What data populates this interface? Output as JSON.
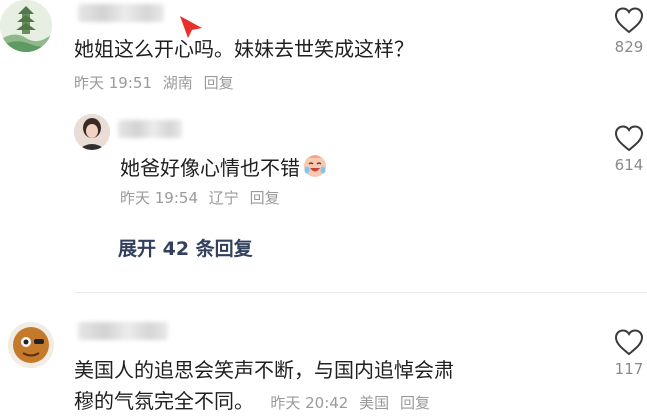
{
  "comments": [
    {
      "text": "她姐这么开心吗。妹妹去世笑成这样？",
      "time": "昨天 19:51",
      "region": "湖南",
      "reply_label": "回复",
      "like_count": "829"
    },
    {
      "text": "她爸好像心情也不错",
      "time": "昨天 19:54",
      "region": "辽宁",
      "reply_label": "回复",
      "like_count": "614"
    },
    {
      "text_line1": "美国人的追思会笑声不断，与国内追悼会肃",
      "text_line2": "穆的气氛完全不同。",
      "time": "昨天 20:42",
      "region": "美国",
      "reply_label": "回复",
      "like_count": "117"
    }
  ],
  "expand_replies": "展开 42 条回复",
  "colors": {
    "accent_link": "#33405c",
    "meta_gray": "#9a9a9a",
    "cursor_red": "#e8302a"
  }
}
